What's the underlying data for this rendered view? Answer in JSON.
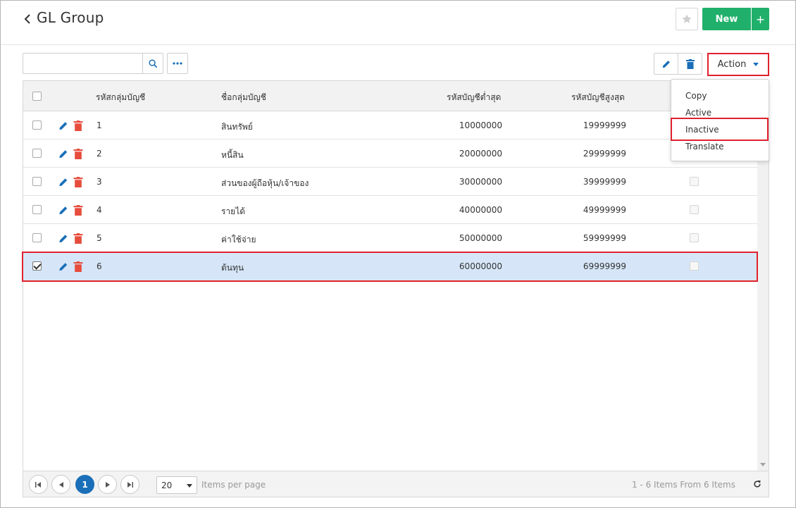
{
  "header": {
    "title": "GL Group",
    "new_label": "New",
    "plus_label": "+"
  },
  "toolbar": {
    "search_placeholder": "",
    "action_label": "Action"
  },
  "action_menu": {
    "items": [
      {
        "label": "Copy"
      },
      {
        "label": "Active"
      },
      {
        "label": "Inactive"
      },
      {
        "label": "Translate"
      }
    ]
  },
  "grid": {
    "columns": {
      "code": "รหัสกลุ่มบัญชี",
      "name": "ชื่อกลุ่มบัญชี",
      "min_account": "รหัสบัญชีต่ำสุด",
      "max_account": "รหัสบัญชีสูงสุด"
    },
    "rows": [
      {
        "code": "1",
        "name": "สินทรัพย์",
        "min": "10000000",
        "max": "19999999",
        "selected": false
      },
      {
        "code": "2",
        "name": "หนี้สิน",
        "min": "20000000",
        "max": "29999999",
        "selected": false
      },
      {
        "code": "3",
        "name": "ส่วนของผู้ถือหุ้น/เจ้าของ",
        "min": "30000000",
        "max": "39999999",
        "selected": false
      },
      {
        "code": "4",
        "name": "รายได้",
        "min": "40000000",
        "max": "49999999",
        "selected": false
      },
      {
        "code": "5",
        "name": "ค่าใช้จ่าย",
        "min": "50000000",
        "max": "59999999",
        "selected": false
      },
      {
        "code": "6",
        "name": "ต้นทุน",
        "min": "60000000",
        "max": "69999999",
        "selected": true
      }
    ]
  },
  "pager": {
    "current_page": "1",
    "page_size": "20",
    "items_per_page_label": "Items per page",
    "info": "1 - 6 Items From 6 Items"
  },
  "colors": {
    "primary_blue": "#1a6fb8",
    "new_green": "#21b06b",
    "delete_red": "#e74c3c",
    "highlight_red": "#e0212e",
    "selected_row": "#d6e6f8"
  }
}
